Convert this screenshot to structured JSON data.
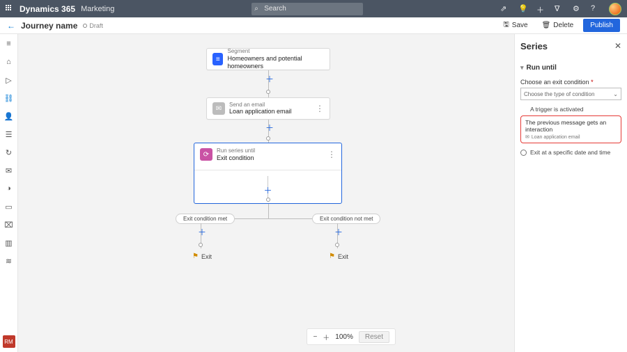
{
  "topbar": {
    "brand": "Dynamics 365",
    "app": "Marketing",
    "search_placeholder": "Search"
  },
  "cmdbar": {
    "title": "Journey name",
    "status": "Draft",
    "save": "Save",
    "delete": "Delete",
    "publish": "Publish"
  },
  "canvas": {
    "segment": {
      "label": "Segment",
      "value": "Homeowners and potential homeowners"
    },
    "email": {
      "label": "Send an email",
      "value": "Loan application email"
    },
    "series": {
      "label": "Run series until",
      "value": "Exit condition"
    },
    "branch_left": "Exit condition met",
    "branch_right": "Exit condition not met",
    "exit": "Exit"
  },
  "zoom": {
    "percent": "100%",
    "reset": "Reset"
  },
  "panel": {
    "title": "Series",
    "section": "Run until",
    "choose_label": "Choose an exit condition",
    "choose_placeholder": "Choose the type of condition",
    "opt_trigger": "A trigger is activated",
    "opt_prevmsg": "The previous message gets an interaction",
    "opt_prevmsg_sub": "Loan application email",
    "opt_datetime": "Exit at a specific date and time"
  },
  "leftnav": {
    "rm": "RM"
  }
}
